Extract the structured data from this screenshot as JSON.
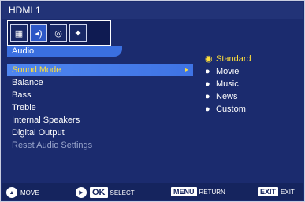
{
  "header": {
    "title": "HDMI 1"
  },
  "icons": [
    {
      "name": "picture-icon",
      "glyph": "▦"
    },
    {
      "name": "speaker-icon",
      "glyph": "◂)"
    },
    {
      "name": "display-icon",
      "glyph": "◎"
    },
    {
      "name": "setup-icon",
      "glyph": "✦"
    }
  ],
  "tab": {
    "label": "Audio"
  },
  "menu": {
    "items": [
      {
        "label": "Sound Mode"
      },
      {
        "label": "Balance"
      },
      {
        "label": "Bass"
      },
      {
        "label": "Treble"
      },
      {
        "label": "Internal Speakers"
      },
      {
        "label": "Digital Output"
      },
      {
        "label": "Reset Audio Settings"
      }
    ],
    "arrow": "▸"
  },
  "options": {
    "items": [
      {
        "label": "Standard",
        "bullet": "◉"
      },
      {
        "label": "Movie",
        "bullet": "●"
      },
      {
        "label": "Music",
        "bullet": "●"
      },
      {
        "label": "News",
        "bullet": "●"
      },
      {
        "label": "Custom",
        "bullet": "●"
      }
    ]
  },
  "footer": {
    "move": "MOVE",
    "ok_key": "OK",
    "select": "SELECT",
    "menu_key": "MENU",
    "return": "RETURN",
    "exit_key": "EXIT",
    "exit": "EXIT"
  },
  "colors": {
    "background": "#1b2b6e",
    "highlight": "#3f73e4",
    "selected_text": "#ffdf3a"
  }
}
